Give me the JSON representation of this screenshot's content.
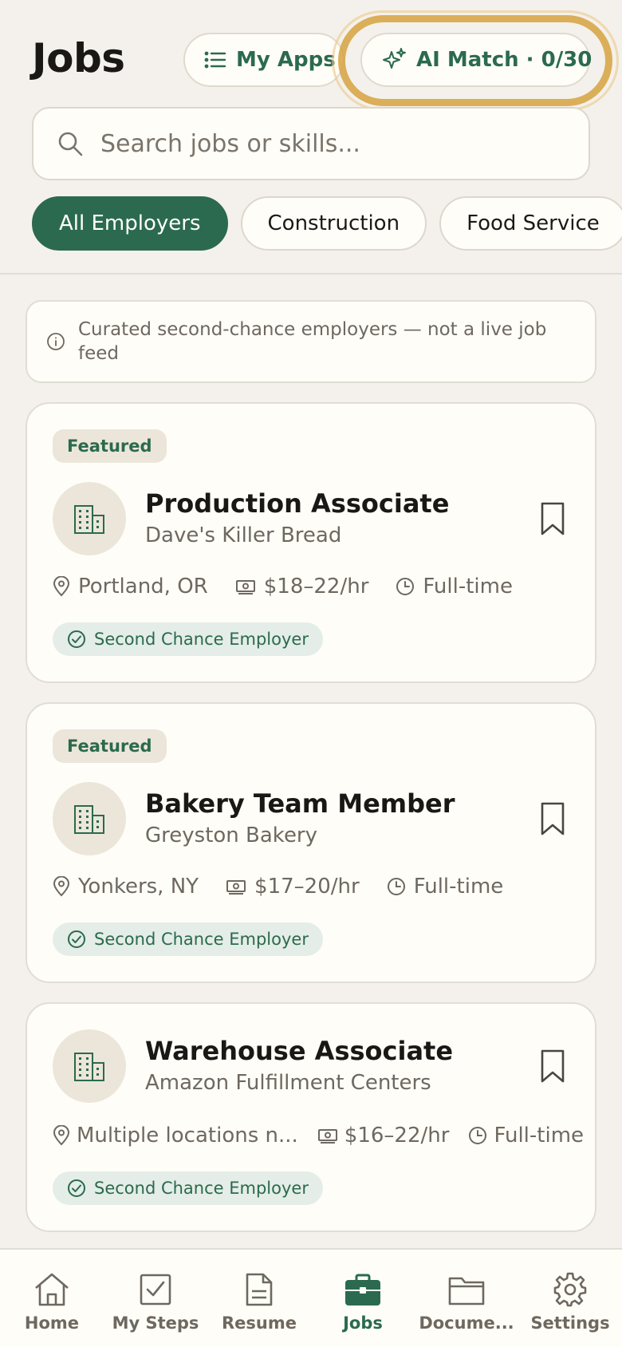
{
  "header": {
    "title": "Jobs",
    "my_apps_label": "My Apps",
    "ai_match_label": "AI Match · 0/30"
  },
  "search": {
    "placeholder": "Search jobs or skills..."
  },
  "filters": [
    {
      "label": "All Employers",
      "active": true
    },
    {
      "label": "Construction",
      "active": false
    },
    {
      "label": "Food Service",
      "active": false
    }
  ],
  "notice": {
    "text": "Curated second-chance employers — not a live job feed"
  },
  "jobs": [
    {
      "featured_label": "Featured",
      "title": "Production Associate",
      "employer": "Dave's Killer Bread",
      "location": "Portland, OR",
      "pay": "$18–22/hr",
      "schedule": "Full-time",
      "badge": "Second Chance Employer"
    },
    {
      "featured_label": "Featured",
      "title": "Bakery Team Member",
      "employer": "Greyston Bakery",
      "location": "Yonkers, NY",
      "pay": "$17–20/hr",
      "schedule": "Full-time",
      "badge": "Second Chance Employer"
    },
    {
      "title": "Warehouse Associate",
      "employer": "Amazon Fulfillment Centers",
      "location": "Multiple locations n...",
      "pay": "$16–22/hr",
      "schedule": "Full-time",
      "badge": "Second Chance Employer"
    }
  ],
  "nav": [
    {
      "label": "Home",
      "icon": "home-icon"
    },
    {
      "label": "My Steps",
      "icon": "checkbox-icon"
    },
    {
      "label": "Resume",
      "icon": "document-icon"
    },
    {
      "label": "Jobs",
      "icon": "briefcase-icon",
      "active": true
    },
    {
      "label": "Docume...",
      "icon": "folder-icon"
    },
    {
      "label": "Settings",
      "icon": "gear-icon"
    }
  ],
  "colors": {
    "brand_green": "#2b6a4e",
    "highlight_ring": "#d6a23f",
    "background": "#f4f1ec",
    "card": "#fffdf8"
  }
}
